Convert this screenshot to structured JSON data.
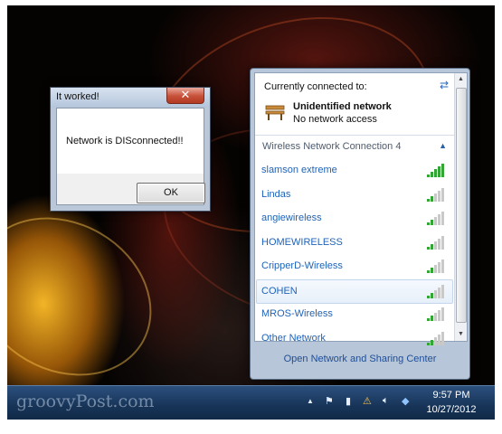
{
  "dialog": {
    "title": "It worked!",
    "close_label": "✕",
    "message": "Network is DISconnected!!",
    "ok_label": "OK"
  },
  "flyout": {
    "header": "Currently connected to:",
    "connection": {
      "name": "Unidentified network",
      "status": "No network access"
    },
    "section_title": "Wireless Network Connection 4",
    "networks": [
      {
        "label": "slamson extreme",
        "signal": 5,
        "green": true
      },
      {
        "label": "Lindas",
        "signal": 5,
        "green": false
      },
      {
        "label": "angiewireless",
        "signal": 5,
        "green": false
      },
      {
        "label": "HOMEWIRELESS",
        "signal": 5,
        "green": false
      },
      {
        "label": "CripperD-Wireless",
        "signal": 5,
        "green": false
      },
      {
        "label": "COHEN",
        "signal": 5,
        "green": false,
        "selected": true
      },
      {
        "label": "MROS-Wireless",
        "signal": 5,
        "green": false
      },
      {
        "label": "Other Network",
        "signal": 5,
        "green": false
      }
    ],
    "footer_link": "Open Network and Sharing Center"
  },
  "taskbar": {
    "watermark": "groovyPost.com",
    "time": "9:57 PM",
    "date": "10/27/2012"
  },
  "colors": {
    "link": "#1f63b8",
    "signal_green": "#33a534"
  }
}
